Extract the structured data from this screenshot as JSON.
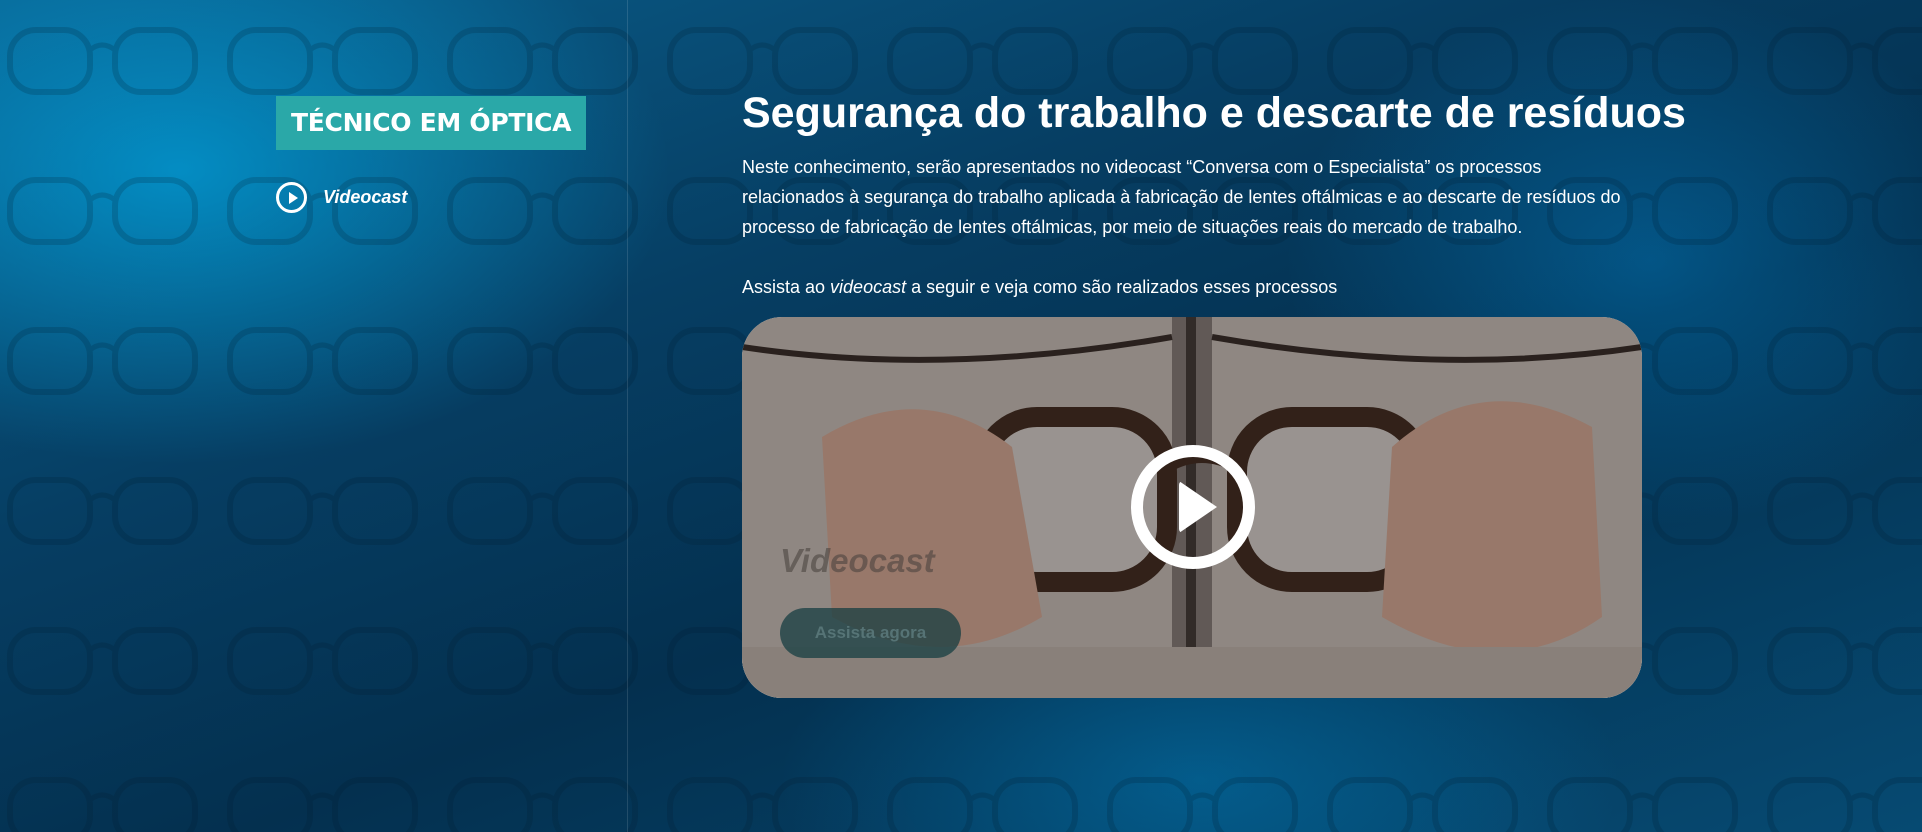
{
  "sidebar": {
    "course_tag": "TÉCNICO EM ÓPTICA",
    "items": [
      {
        "label": "Videocast",
        "icon": "play-circle-icon"
      }
    ]
  },
  "main": {
    "title": "Segurança do trabalho e descarte de resíduos",
    "description": "Neste conhecimento, serão apresentados no videocast “Conversa com o Especialista” os processos relacionados à segurança do trabalho aplicada à fabricação de lentes oftálmicas e ao descarte de resíduos do processo de fabricação de lentes oftálmicas, por meio de situações reais do mercado de trabalho.",
    "cta_prefix": "Assista ao ",
    "cta_emphasis": "videocast",
    "cta_suffix": " a seguir e veja como são realizados esses processos",
    "video": {
      "title": "Videocast",
      "button_label": "Assista agora",
      "play_icon": "play-circle-icon"
    }
  },
  "colors": {
    "tag_background": "#2aa8a8",
    "background_dark": "#04304f",
    "background_light": "#00beff",
    "text": "#ffffff"
  }
}
